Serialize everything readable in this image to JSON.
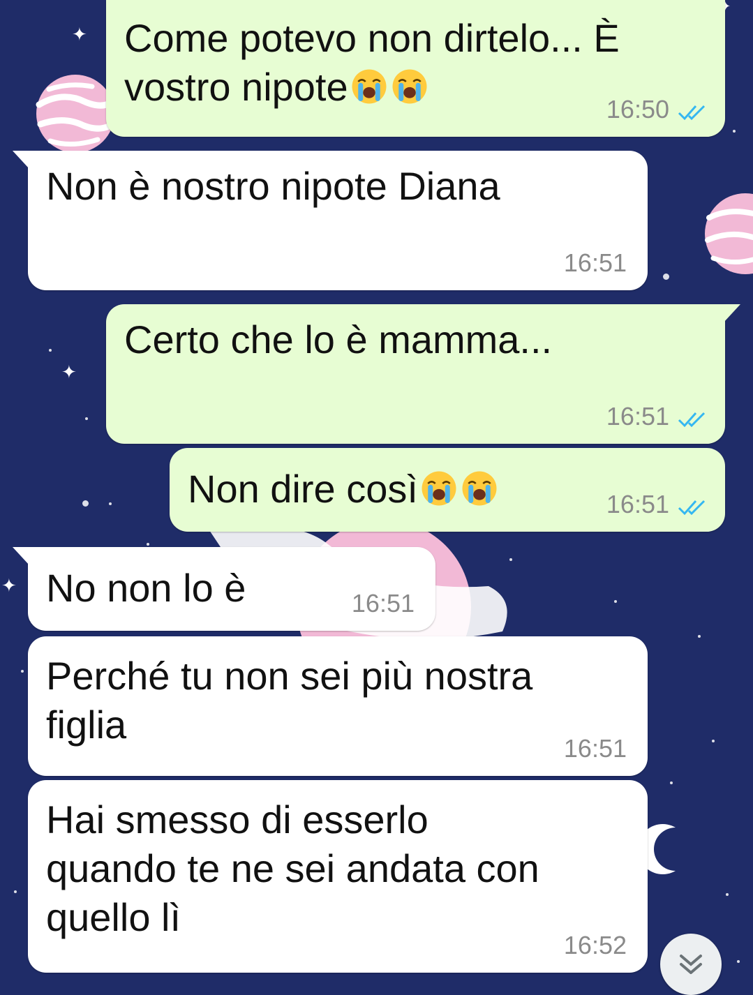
{
  "chat": {
    "messages": [
      {
        "direction": "outgoing",
        "text": "Come potevo non dirtelo... È\nvostro nipote",
        "emoji": [
          "loudly-crying-face",
          "loudly-crying-face"
        ],
        "time": "16:50",
        "status": "read"
      },
      {
        "direction": "incoming",
        "text": "Non è nostro nipote Diana",
        "time": "16:51"
      },
      {
        "direction": "outgoing",
        "text": "Certo che lo è mamma...",
        "time": "16:51",
        "status": "read"
      },
      {
        "direction": "outgoing",
        "text": "Non dire così",
        "emoji": [
          "loudly-crying-face",
          "loudly-crying-face"
        ],
        "time": "16:51",
        "status": "read"
      },
      {
        "direction": "incoming",
        "text": "No non lo è",
        "time": "16:51"
      },
      {
        "direction": "incoming",
        "text": "Perché tu non sei più nostra\nfiglia",
        "time": "16:51"
      },
      {
        "direction": "incoming",
        "text": "Hai smesso di esserlo\nquando te ne sei andata con\nquello lì",
        "time": "16:52"
      }
    ]
  },
  "colors": {
    "background": "#1f2c68",
    "outgoing_bubble": "#e7fdd3",
    "incoming_bubble": "#ffffff",
    "read_ticks": "#34b7f1",
    "timestamp": "#8a8a8a"
  },
  "controls": {
    "scroll_button_icon": "chevron-double-down-icon"
  }
}
